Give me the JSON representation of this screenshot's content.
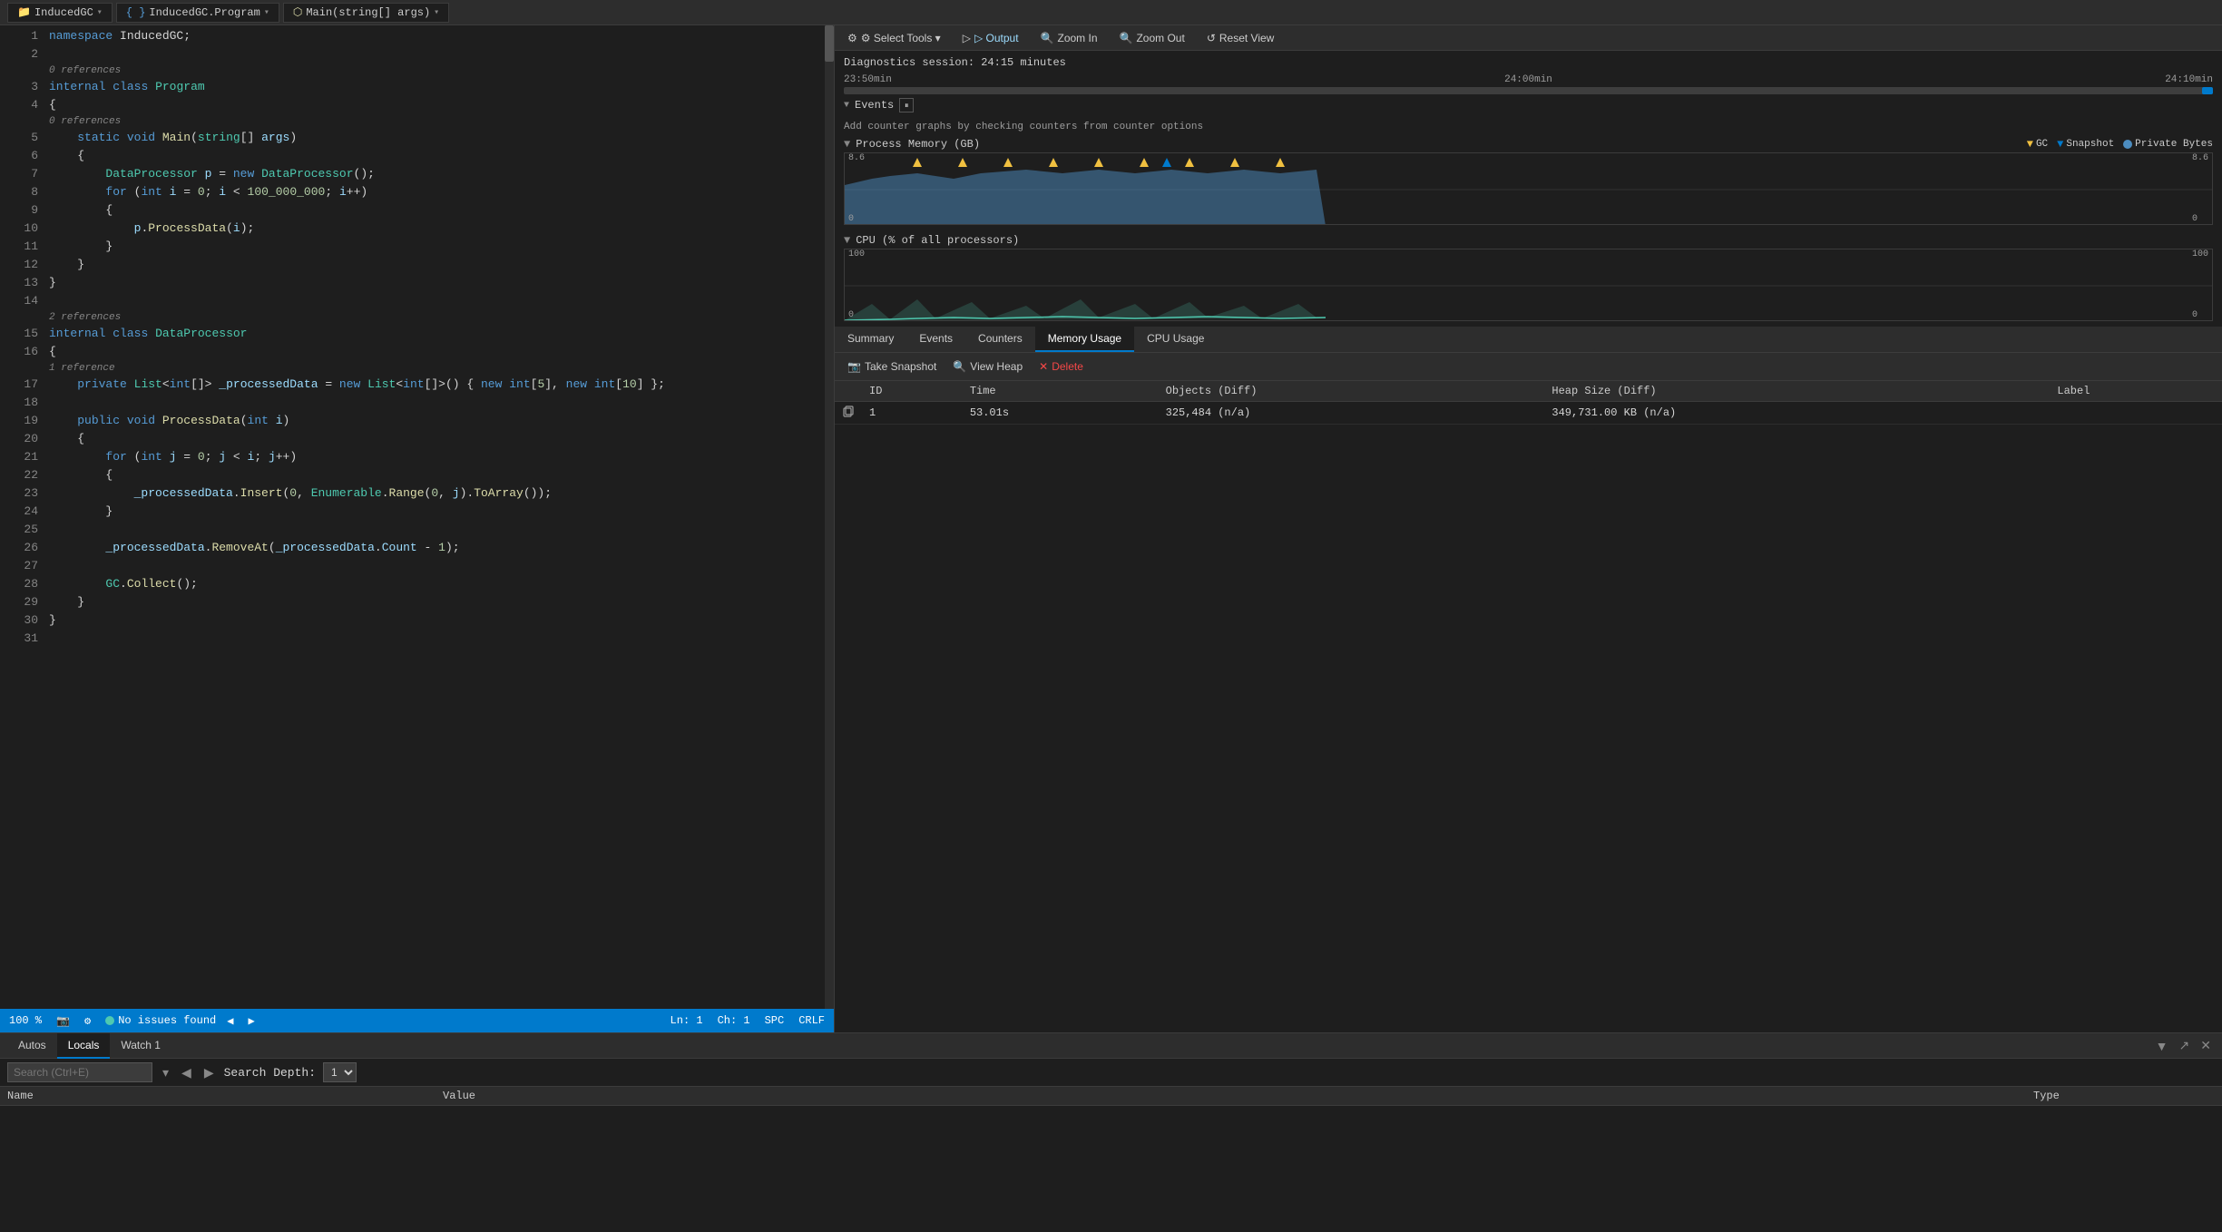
{
  "titlebar": {
    "project": "InducedGC",
    "file": "InducedGC.Program",
    "method": "Main(string[] args)",
    "arrow": "▾"
  },
  "diagnostics": {
    "toolbar": {
      "select_tools": "⚙ Select Tools ▾",
      "output": "▷ Output",
      "zoom_in": "🔍 Zoom In",
      "zoom_out": "🔍 Zoom Out",
      "reset_view": "↺ Reset View"
    },
    "session": {
      "label": "Diagnostics session: 24:15 minutes"
    },
    "timeline": {
      "labels": [
        "23:50min",
        "24:00min",
        "24:10min"
      ]
    },
    "events_header": "Events",
    "counter_hint": "Add counter graphs by checking counters from counter options",
    "process_memory": {
      "title": "Process Memory (GB)",
      "legend": [
        {
          "label": "GC",
          "color": "#f0c040",
          "shape": "triangle"
        },
        {
          "label": "Snapshot",
          "color": "#007acc",
          "shape": "triangle-down"
        },
        {
          "label": "Private Bytes",
          "color": "#4c8cbf",
          "shape": "circle"
        }
      ],
      "y_max": "8.6",
      "y_min": "0"
    },
    "cpu": {
      "title": "CPU (% of all processors)",
      "y_max": "100",
      "y_min": "0"
    },
    "tabs": [
      {
        "label": "Summary",
        "id": "summary"
      },
      {
        "label": "Events",
        "id": "events"
      },
      {
        "label": "Counters",
        "id": "counters"
      },
      {
        "label": "Memory Usage",
        "id": "memory-usage",
        "active": true
      },
      {
        "label": "CPU Usage",
        "id": "cpu-usage"
      }
    ],
    "memory_toolbar": {
      "take_snapshot": "Take Snapshot",
      "view_heap": "View Heap",
      "delete": "Delete"
    },
    "snapshot_table": {
      "headers": [
        "ID",
        "Time",
        "Objects (Diff)",
        "Heap Size (Diff)",
        "Label"
      ],
      "rows": [
        {
          "id": "1",
          "time": "53.01s",
          "objects": "325,484  (n/a)",
          "heap_size": "349,731.00 KB  (n/a)",
          "label": ""
        }
      ]
    }
  },
  "code": {
    "lines": [
      {
        "num": 1,
        "indent": 0,
        "tokens": [
          {
            "t": "kw",
            "v": "namespace"
          },
          {
            "t": "",
            "v": " InducedGC;"
          }
        ],
        "collapse": null,
        "ref": null
      },
      {
        "num": 2,
        "indent": 0,
        "tokens": [],
        "collapse": null,
        "ref": null
      },
      {
        "num": 3,
        "indent": 0,
        "tokens": [
          {
            "t": "ref",
            "v": "0 references"
          }
        ],
        "ref_line": true
      },
      {
        "num": 3,
        "indent": 0,
        "tokens": [
          {
            "t": "kw",
            "v": "internal"
          },
          {
            "t": "",
            "v": " "
          },
          {
            "t": "kw",
            "v": "class"
          },
          {
            "t": "",
            "v": " "
          },
          {
            "t": "type",
            "v": "Program"
          }
        ],
        "collapse": "▾",
        "ref": null
      },
      {
        "num": 4,
        "indent": 0,
        "tokens": [
          {
            "t": "",
            "v": "{"
          }
        ],
        "collapse": null,
        "ref": null
      },
      {
        "num": 5,
        "indent": 1,
        "tokens": [
          {
            "t": "ref",
            "v": "0 references"
          }
        ],
        "ref_line": true
      },
      {
        "num": 5,
        "indent": 1,
        "tokens": [
          {
            "t": "kw",
            "v": "static"
          },
          {
            "t": "",
            "v": " "
          },
          {
            "t": "kw",
            "v": "void"
          },
          {
            "t": "",
            "v": " "
          },
          {
            "t": "method",
            "v": "Main"
          },
          {
            "t": "",
            "v": "("
          },
          {
            "t": "type",
            "v": "string"
          },
          {
            "t": "",
            "v": "[] "
          },
          {
            "t": "var",
            "v": "args"
          },
          {
            "t": "",
            "v": ")"
          }
        ],
        "collapse": "▾",
        "ref": null
      },
      {
        "num": 6,
        "indent": 1,
        "tokens": [
          {
            "t": "",
            "v": "{"
          }
        ],
        "collapse": null,
        "ref": null
      },
      {
        "num": 7,
        "indent": 2,
        "tokens": [
          {
            "t": "type",
            "v": "DataProcessor"
          },
          {
            "t": "",
            "v": " "
          },
          {
            "t": "var",
            "v": "p"
          },
          {
            "t": "",
            "v": " = "
          },
          {
            "t": "kw",
            "v": "new"
          },
          {
            "t": "",
            "v": " "
          },
          {
            "t": "type",
            "v": "DataProcessor"
          },
          {
            "t": "",
            "v": "();"
          }
        ],
        "collapse": null,
        "ref": null
      },
      {
        "num": 8,
        "indent": 2,
        "tokens": [
          {
            "t": "kw",
            "v": "for"
          },
          {
            "t": "",
            "v": " ("
          },
          {
            "t": "kw",
            "v": "int"
          },
          {
            "t": "",
            "v": " "
          },
          {
            "t": "var",
            "v": "i"
          },
          {
            "t": "",
            "v": " = "
          },
          {
            "t": "num",
            "v": "0"
          },
          {
            "t": "",
            "v": "; "
          },
          {
            "t": "var",
            "v": "i"
          },
          {
            "t": "",
            "v": " < "
          },
          {
            "t": "num",
            "v": "100_000_000"
          },
          {
            "t": "",
            "v": "; "
          },
          {
            "t": "var",
            "v": "i"
          },
          {
            "t": "",
            "v": "++)"
          }
        ],
        "collapse": "▾",
        "ref": null
      },
      {
        "num": 9,
        "indent": 2,
        "tokens": [
          {
            "t": "",
            "v": "{"
          }
        ],
        "collapse": null,
        "ref": null
      },
      {
        "num": 10,
        "indent": 3,
        "tokens": [
          {
            "t": "var",
            "v": "p"
          },
          {
            "t": "",
            "v": "."
          },
          {
            "t": "method",
            "v": "ProcessData"
          },
          {
            "t": "",
            "v": "("
          },
          {
            "t": "var",
            "v": "i"
          },
          {
            "t": "",
            "v": ");"
          }
        ],
        "collapse": null,
        "ref": null
      },
      {
        "num": 11,
        "indent": 2,
        "tokens": [
          {
            "t": "",
            "v": "}"
          }
        ],
        "collapse": null,
        "ref": null
      },
      {
        "num": 12,
        "indent": 1,
        "tokens": [
          {
            "t": "",
            "v": "}"
          }
        ],
        "collapse": null,
        "ref": null
      },
      {
        "num": 13,
        "indent": 0,
        "tokens": [
          {
            "t": "",
            "v": "}"
          }
        ],
        "collapse": null,
        "ref": null
      },
      {
        "num": 14,
        "indent": 0,
        "tokens": [],
        "collapse": null,
        "ref": null
      },
      {
        "num": 15,
        "indent": 0,
        "tokens": [
          {
            "t": "ref",
            "v": "2 references"
          }
        ],
        "ref_line": true
      },
      {
        "num": 15,
        "indent": 0,
        "tokens": [
          {
            "t": "kw",
            "v": "internal"
          },
          {
            "t": "",
            "v": " "
          },
          {
            "t": "kw",
            "v": "class"
          },
          {
            "t": "",
            "v": " "
          },
          {
            "t": "type",
            "v": "DataProcessor"
          }
        ],
        "collapse": "▾",
        "ref": null
      },
      {
        "num": 16,
        "indent": 0,
        "tokens": [
          {
            "t": "",
            "v": "{"
          }
        ],
        "collapse": null,
        "ref": null
      },
      {
        "num": 17,
        "indent": 1,
        "tokens": [
          {
            "t": "ref",
            "v": "1 reference"
          }
        ],
        "ref_line": true
      },
      {
        "num": 17,
        "indent": 1,
        "tokens": [
          {
            "t": "kw",
            "v": "private"
          },
          {
            "t": "",
            "v": " "
          },
          {
            "t": "type",
            "v": "List"
          },
          {
            "t": "",
            "v": "<"
          },
          {
            "t": "kw",
            "v": "int"
          },
          {
            "t": "",
            "v": "[]> "
          },
          {
            "t": "var",
            "v": "_processedData"
          },
          {
            "t": "",
            "v": " = "
          },
          {
            "t": "kw",
            "v": "new"
          },
          {
            "t": "",
            "v": " "
          },
          {
            "t": "type",
            "v": "List"
          },
          {
            "t": "",
            "v": "<"
          },
          {
            "t": "kw",
            "v": "int"
          },
          {
            "t": "",
            "v": "[]>() { "
          },
          {
            "t": "kw",
            "v": "new"
          },
          {
            "t": "",
            "v": " "
          },
          {
            "t": "kw",
            "v": "int"
          },
          {
            "t": "",
            "v": "["
          },
          {
            "t": "num",
            "v": "5"
          },
          {
            "t": "",
            "v": "], "
          },
          {
            "t": "kw",
            "v": "new"
          },
          {
            "t": "",
            "v": " "
          },
          {
            "t": "kw",
            "v": "int"
          },
          {
            "t": "",
            "v": "["
          },
          {
            "t": "num",
            "v": "10"
          },
          {
            "t": "",
            "v": "] };"
          }
        ],
        "collapse": null,
        "ref": null
      },
      {
        "num": 18,
        "indent": 0,
        "tokens": [],
        "collapse": null,
        "ref": null
      },
      {
        "num": 19,
        "indent": 1,
        "tokens": [
          {
            "t": "kw",
            "v": "public"
          },
          {
            "t": "",
            "v": " "
          },
          {
            "t": "kw",
            "v": "void"
          },
          {
            "t": "",
            "v": " "
          },
          {
            "t": "method",
            "v": "ProcessData"
          },
          {
            "t": "",
            "v": "("
          },
          {
            "t": "kw",
            "v": "int"
          },
          {
            "t": "",
            "v": " "
          },
          {
            "t": "var",
            "v": "i"
          },
          {
            "t": "",
            "v": ")"
          }
        ],
        "collapse": "▾",
        "ref": null
      },
      {
        "num": 20,
        "indent": 1,
        "tokens": [
          {
            "t": "",
            "v": "{"
          }
        ],
        "collapse": null,
        "ref": null
      },
      {
        "num": 21,
        "indent": 2,
        "tokens": [
          {
            "t": "kw",
            "v": "for"
          },
          {
            "t": "",
            "v": " ("
          },
          {
            "t": "kw",
            "v": "int"
          },
          {
            "t": "",
            "v": " "
          },
          {
            "t": "var",
            "v": "j"
          },
          {
            "t": "",
            "v": " = "
          },
          {
            "t": "num",
            "v": "0"
          },
          {
            "t": "",
            "v": "; "
          },
          {
            "t": "var",
            "v": "j"
          },
          {
            "t": "",
            "v": " < "
          },
          {
            "t": "var",
            "v": "i"
          },
          {
            "t": "",
            "v": "; "
          },
          {
            "t": "var",
            "v": "j"
          },
          {
            "t": "",
            "v": "++)"
          }
        ],
        "collapse": "▾",
        "ref": null
      },
      {
        "num": 22,
        "indent": 2,
        "tokens": [
          {
            "t": "",
            "v": "{"
          }
        ],
        "collapse": null,
        "ref": null
      },
      {
        "num": 23,
        "indent": 3,
        "tokens": [
          {
            "t": "var",
            "v": "_processedData"
          },
          {
            "t": "",
            "v": "."
          },
          {
            "t": "method",
            "v": "Insert"
          },
          {
            "t": "",
            "v": "("
          },
          {
            "t": "num",
            "v": "0"
          },
          {
            "t": "",
            "v": ", "
          },
          {
            "t": "type",
            "v": "Enumerable"
          },
          {
            "t": "",
            "v": "."
          },
          {
            "t": "method",
            "v": "Range"
          },
          {
            "t": "",
            "v": "("
          },
          {
            "t": "num",
            "v": "0"
          },
          {
            "t": "",
            "v": ", "
          },
          {
            "t": "var",
            "v": "j"
          },
          {
            "t": "",
            "v": ")."
          },
          {
            "t": "method",
            "v": "ToArray"
          },
          {
            "t": "",
            "v": "());"
          }
        ],
        "collapse": null,
        "ref": null
      },
      {
        "num": 24,
        "indent": 2,
        "tokens": [
          {
            "t": "",
            "v": "}"
          }
        ],
        "collapse": null,
        "ref": null
      },
      {
        "num": 25,
        "indent": 0,
        "tokens": [],
        "collapse": null,
        "ref": null
      },
      {
        "num": 26,
        "indent": 2,
        "tokens": [
          {
            "t": "var",
            "v": "_processedData"
          },
          {
            "t": "",
            "v": "."
          },
          {
            "t": "method",
            "v": "RemoveAt"
          },
          {
            "t": "",
            "v": "("
          },
          {
            "t": "var",
            "v": "_processedData"
          },
          {
            "t": "",
            "v": "."
          },
          {
            "t": "var",
            "v": "Count"
          },
          {
            "t": "",
            "v": " - "
          },
          {
            "t": "num",
            "v": "1"
          },
          {
            "t": "",
            "v": ");"
          }
        ],
        "collapse": null,
        "ref": null
      },
      {
        "num": 27,
        "indent": 0,
        "tokens": [],
        "collapse": null,
        "ref": null
      },
      {
        "num": 28,
        "indent": 2,
        "tokens": [
          {
            "t": "type",
            "v": "GC"
          },
          {
            "t": "",
            "v": "."
          },
          {
            "t": "method",
            "v": "Collect"
          },
          {
            "t": "",
            "v": "();"
          }
        ],
        "collapse": null,
        "ref": null
      },
      {
        "num": 29,
        "indent": 1,
        "tokens": [
          {
            "t": "",
            "v": "}"
          }
        ],
        "collapse": null,
        "ref": null
      },
      {
        "num": 30,
        "indent": 0,
        "tokens": [
          {
            "t": "",
            "v": "}"
          }
        ],
        "collapse": null,
        "ref": null
      },
      {
        "num": 31,
        "indent": 0,
        "tokens": [],
        "collapse": null,
        "ref": null
      }
    ]
  },
  "statusbar": {
    "zoom": "100 %",
    "no_issues": "No issues found",
    "ln": "Ln: 1",
    "ch": "Ch: 1",
    "space": "SPC",
    "crlf": "CRLF"
  },
  "bottom": {
    "tabs": [
      {
        "label": "Autos",
        "id": "autos"
      },
      {
        "label": "Locals",
        "id": "locals",
        "active": true
      },
      {
        "label": "Watch 1",
        "id": "watch1"
      }
    ],
    "search_placeholder": "Search (Ctrl+E)",
    "search_depth_label": "Search Depth:",
    "cols": [
      "Name",
      "Value",
      "Type"
    ]
  }
}
